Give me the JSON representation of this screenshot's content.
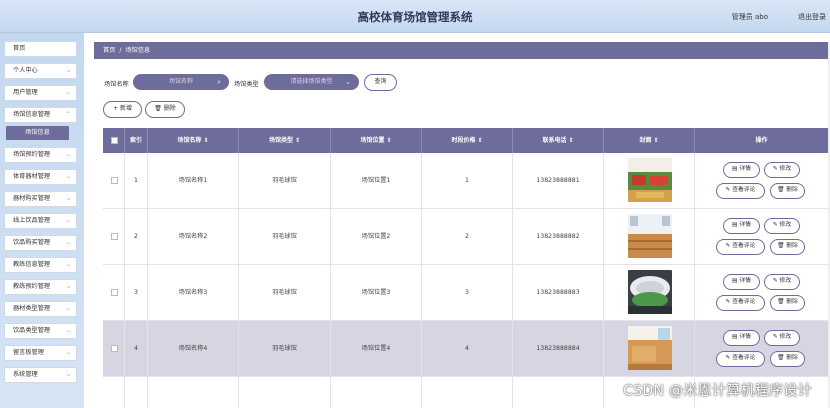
{
  "header": {
    "title": "高校体育场馆管理系统",
    "admin": "管理员 abo",
    "logout": "退出登录"
  },
  "sidebar": {
    "items": [
      {
        "label": "首页",
        "chevron": false
      },
      {
        "label": "个人中心",
        "chevron": true
      },
      {
        "label": "用户管理",
        "chevron": true
      },
      {
        "label": "场馆信息管理",
        "chevron": true
      },
      {
        "label": "场馆预约管理",
        "chevron": true
      },
      {
        "label": "体育器材管理",
        "chevron": true
      },
      {
        "label": "器材购买管理",
        "chevron": true
      },
      {
        "label": "线上饮品管理",
        "chevron": true
      },
      {
        "label": "饮品购买管理",
        "chevron": true
      },
      {
        "label": "教练信息管理",
        "chevron": true
      },
      {
        "label": "教练预约管理",
        "chevron": true
      },
      {
        "label": "器材类型管理",
        "chevron": true
      },
      {
        "label": "饮品类型管理",
        "chevron": true
      },
      {
        "label": "留言板管理",
        "chevron": true
      },
      {
        "label": "系统管理",
        "chevron": true
      }
    ],
    "active_sub": "场馆信息"
  },
  "breadcrumb": {
    "home": "首页",
    "sep": "/",
    "current": "场馆信息"
  },
  "search": {
    "name_label": "场馆名称",
    "name_placeholder": "场馆名称",
    "type_label": "场馆类型",
    "type_placeholder": "请选择场馆类型",
    "query_button": "查询"
  },
  "actions": {
    "add": "+ 新增",
    "delete": "删除"
  },
  "table": {
    "columns": [
      "索引",
      "场馆名称 ⇕",
      "场馆类型 ⇕",
      "场馆位置 ⇕",
      "时段价格 ⇕",
      "联系电话 ⇕",
      "封面 ⇕",
      "操作"
    ],
    "rows": [
      {
        "index": "1",
        "name": "场馆名称1",
        "type": "羽毛球馆",
        "location": "场馆位置1",
        "price": "1",
        "phone": "13823888881"
      },
      {
        "index": "2",
        "name": "场馆名称2",
        "type": "羽毛球馆",
        "location": "场馆位置2",
        "price": "2",
        "phone": "13823888882"
      },
      {
        "index": "3",
        "name": "场馆名称3",
        "type": "羽毛球馆",
        "location": "场馆位置3",
        "price": "3",
        "phone": "13823888883"
      },
      {
        "index": "4",
        "name": "场馆名称4",
        "type": "羽毛球馆",
        "location": "场馆位置4",
        "price": "4",
        "phone": "13823888884"
      }
    ],
    "ops": {
      "detail": "详情",
      "edit": "修改",
      "comments": "查看评论",
      "delete": "删除"
    }
  },
  "watermark": "CSDN @米恩计算机程序设计",
  "colors": {
    "accent": "#6e6c9a",
    "header_bg": "#c3d8ef"
  }
}
